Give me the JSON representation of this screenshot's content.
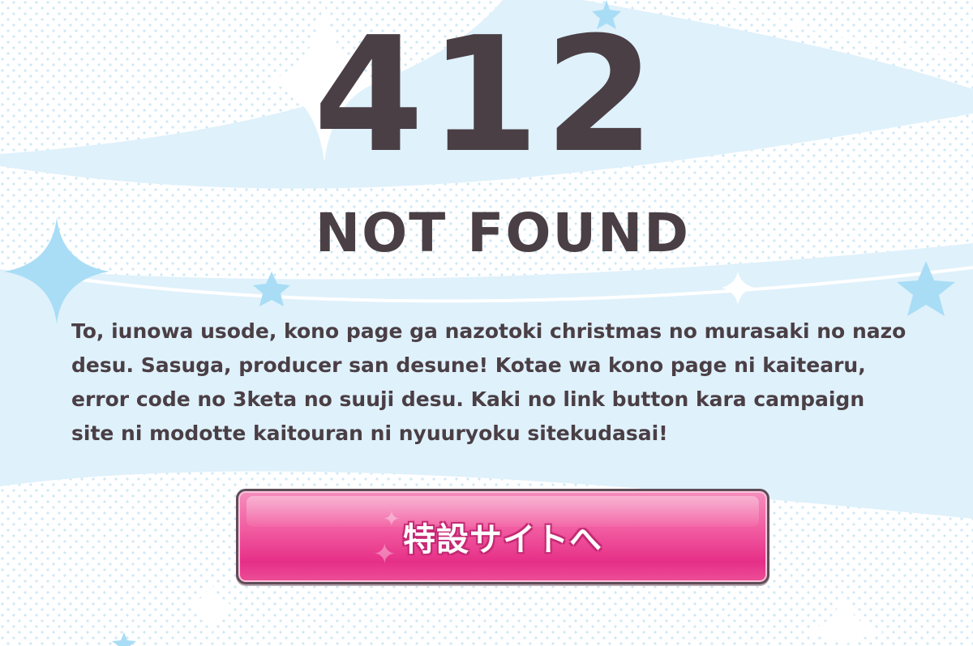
{
  "error": {
    "code": "412",
    "title": "NOT FOUND",
    "message": "To, iunowa usode, kono page ga nazotoki christmas no murasaki no nazo desu. Sasuga, producer san desune! Kotae wa kono page ni kaitearu, error code no 3keta no suuji desu. Kaki no link button kara campaign site ni modotte kaitouran ni nyuuryoku sitekudasai!"
  },
  "button": {
    "label": "特設サイトへ"
  },
  "colors": {
    "background": "#dff1fb",
    "text": "#4a3f45",
    "accent_pink": "#f25ea2",
    "star_blue": "#a9ddf6"
  },
  "decorations": {
    "icons": [
      "sparkle-icon",
      "star-icon"
    ]
  }
}
